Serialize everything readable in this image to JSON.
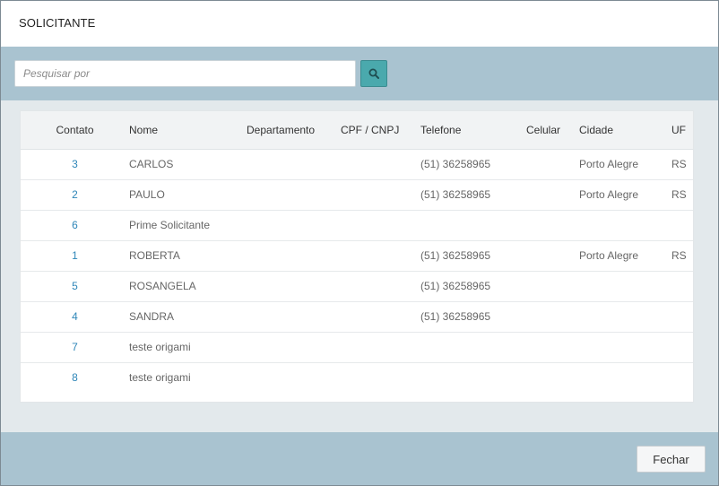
{
  "modal": {
    "title": "SOLICITANTE"
  },
  "search": {
    "placeholder": "Pesquisar por",
    "value": "",
    "icon": "search-icon"
  },
  "table": {
    "columns": [
      "Contato",
      "Nome",
      "Departamento",
      "CPF / CNPJ",
      "Telefone",
      "Celular",
      "Cidade",
      "UF"
    ],
    "rows": [
      [
        "3",
        "CARLOS",
        "",
        "",
        "(51) 36258965",
        "",
        "Porto Alegre",
        "RS"
      ],
      [
        "2",
        "PAULO",
        "",
        "",
        "(51) 36258965",
        "",
        "Porto Alegre",
        "RS"
      ],
      [
        "6",
        "Prime Solicitante",
        "",
        "",
        "",
        "",
        "",
        ""
      ],
      [
        "1",
        "ROBERTA",
        "",
        "",
        "(51) 36258965",
        "",
        "Porto Alegre",
        "RS"
      ],
      [
        "5",
        "ROSANGELA",
        "",
        "",
        "(51) 36258965",
        "",
        "",
        ""
      ],
      [
        "4",
        "SANDRA",
        "",
        "",
        "(51) 36258965",
        "",
        "",
        ""
      ],
      [
        "7",
        "teste origami",
        "",
        "",
        "",
        "",
        "",
        ""
      ],
      [
        "8",
        "teste origami",
        "",
        "",
        "",
        "",
        "",
        ""
      ]
    ]
  },
  "footer": {
    "close_label": "Fechar"
  },
  "colors": {
    "accent": "#4aa9ad",
    "band": "#a9c3d0",
    "body_bg": "#e3e9ec",
    "link": "#2e86b8"
  }
}
